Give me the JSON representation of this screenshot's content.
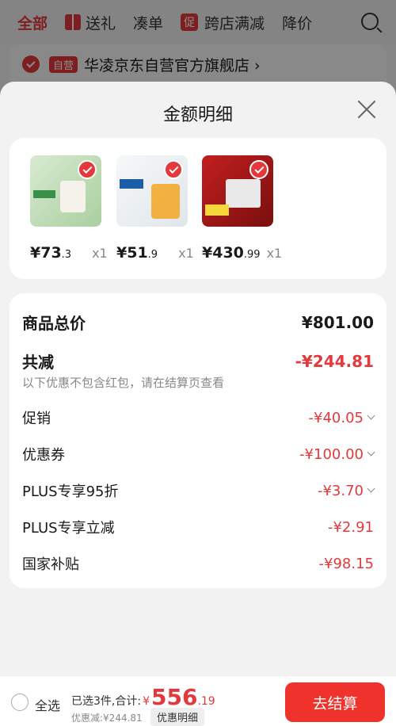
{
  "background": {
    "tabs": [
      "全部",
      "送礼",
      "凑单",
      "跨店满减",
      "降价"
    ],
    "tab_badge": "促",
    "shop_badge": "自营",
    "shop_name": "华凌京东自营官方旗舰店 ›"
  },
  "sheet": {
    "title": "金额明细"
  },
  "products": [
    {
      "price_main": "¥73",
      "price_dec": ".3",
      "qty": "x1",
      "image_color": "#cfe3c8"
    },
    {
      "price_main": "¥51",
      "price_dec": ".9",
      "qty": "x1",
      "image_color": "#f2f4f5"
    },
    {
      "price_main": "¥430",
      "price_dec": ".99",
      "qty": "x1",
      "image_color": "#b01a1a"
    }
  ],
  "summary": {
    "total_label": "商品总价",
    "total_value": "¥801.00",
    "reduce_label": "共减",
    "reduce_value": "-¥244.81",
    "reduce_note": "以下优惠不包含红包，请在结算页查看",
    "items": [
      {
        "label": "促销",
        "value": "-¥40.05",
        "expand": true
      },
      {
        "label": "优惠券",
        "value": "-¥100.00",
        "expand": true
      },
      {
        "label": "PLUS专享95折",
        "value": "-¥3.70",
        "expand": true
      },
      {
        "label": "PLUS专享立减",
        "value": "-¥2.91",
        "expand": false
      },
      {
        "label": "国家补贴",
        "value": "-¥98.15",
        "expand": false
      }
    ]
  },
  "bottom_bar": {
    "select_all": "全选",
    "selected_text": "已选3件,合计:",
    "currency": "¥",
    "amount": "556",
    "amount_dec": ".19",
    "savings": "优惠减:¥244.81",
    "detail_button": "优惠明细",
    "pay_button": "去结算"
  }
}
